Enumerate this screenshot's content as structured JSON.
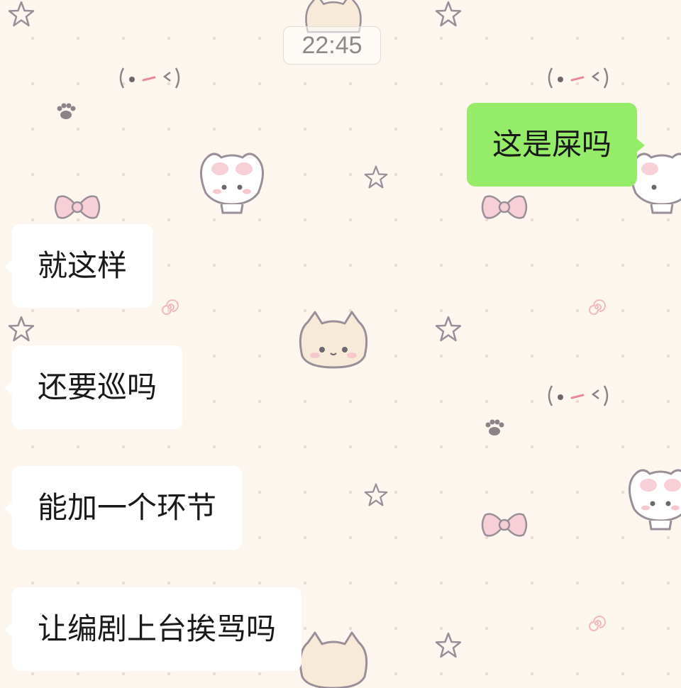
{
  "chat": {
    "timestamp": "22:45",
    "messages": [
      {
        "side": "outgoing",
        "text": "这是屎吗"
      },
      {
        "side": "incoming",
        "text": "就这样"
      },
      {
        "side": "incoming",
        "text": "还要巡吗"
      },
      {
        "side": "incoming",
        "text": "能加一个环节"
      },
      {
        "side": "incoming",
        "text": "让编剧上台挨骂吗"
      }
    ]
  },
  "wallpaper": {
    "theme": "cute kitten pattern",
    "background_color": "#fdf6ee",
    "icons": [
      "star-icon",
      "kitten-face-icon",
      "bunny-icon",
      "bow-icon",
      "paw-icon",
      "spiral-icon",
      "kaomoji-face-icon"
    ]
  },
  "colors": {
    "incoming_bubble": "#ffffff",
    "outgoing_bubble": "#95ec69",
    "text": "#191919",
    "timestamp_text": "#8a8a8a"
  }
}
